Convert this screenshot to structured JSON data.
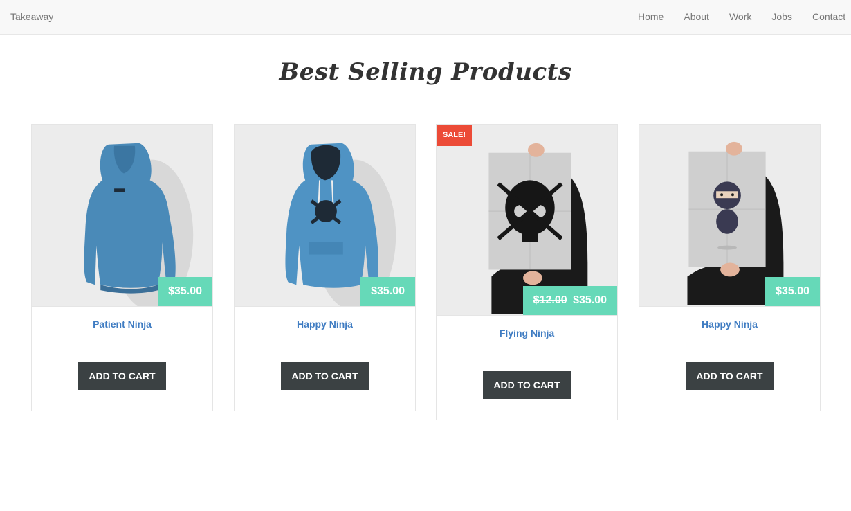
{
  "nav": {
    "brand": "Takeaway",
    "links": [
      "Home",
      "About",
      "Work",
      "Jobs",
      "Contact"
    ]
  },
  "page": {
    "title": "Best Selling Products"
  },
  "products": [
    {
      "name": "Patient Ninja",
      "price": "$35.00",
      "old_price": "",
      "sale": "",
      "button": "ADD TO CART",
      "image": "blue-hoodie-back"
    },
    {
      "name": "Happy Ninja",
      "price": "$35.00",
      "old_price": "",
      "sale": "",
      "button": "ADD TO CART",
      "image": "blue-hoodie-front"
    },
    {
      "name": "Flying Ninja",
      "price": "$35.00",
      "old_price": "$12.00",
      "sale": "SALE!",
      "button": "ADD TO CART",
      "image": "skull-poster"
    },
    {
      "name": "Happy Ninja",
      "price": "$35.00",
      "old_price": "",
      "sale": "",
      "button": "ADD TO CART",
      "image": "ninja-poster"
    }
  ],
  "colors": {
    "price_tag": "#66d9b8",
    "sale_badge": "#ec4b37",
    "link": "#3f7cc2",
    "button": "#3b4143",
    "navbar": "#f8f8f8"
  }
}
